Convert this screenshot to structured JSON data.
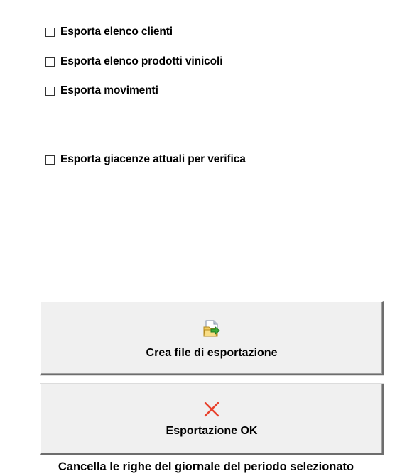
{
  "options": [
    {
      "id": "clienti",
      "label": "Esporta elenco clienti",
      "checked": false
    },
    {
      "id": "prodotti",
      "label": "Esporta elenco prodotti vinicoli",
      "checked": false
    },
    {
      "id": "movimenti",
      "label": "Esporta movimenti",
      "checked": false
    },
    {
      "id": "giacenze",
      "label": "Esporta giacenze attuali per verifica",
      "checked": false
    }
  ],
  "buttons": {
    "export": {
      "label": "Crea file di esportazione",
      "icon": "export-file-icon"
    },
    "ok": {
      "label": "Esportazione OK",
      "icon": "red-x-icon",
      "icon_color": "#e8412c"
    }
  },
  "footer": {
    "text": "Cancella le righe del giornale del periodo selezionato"
  }
}
